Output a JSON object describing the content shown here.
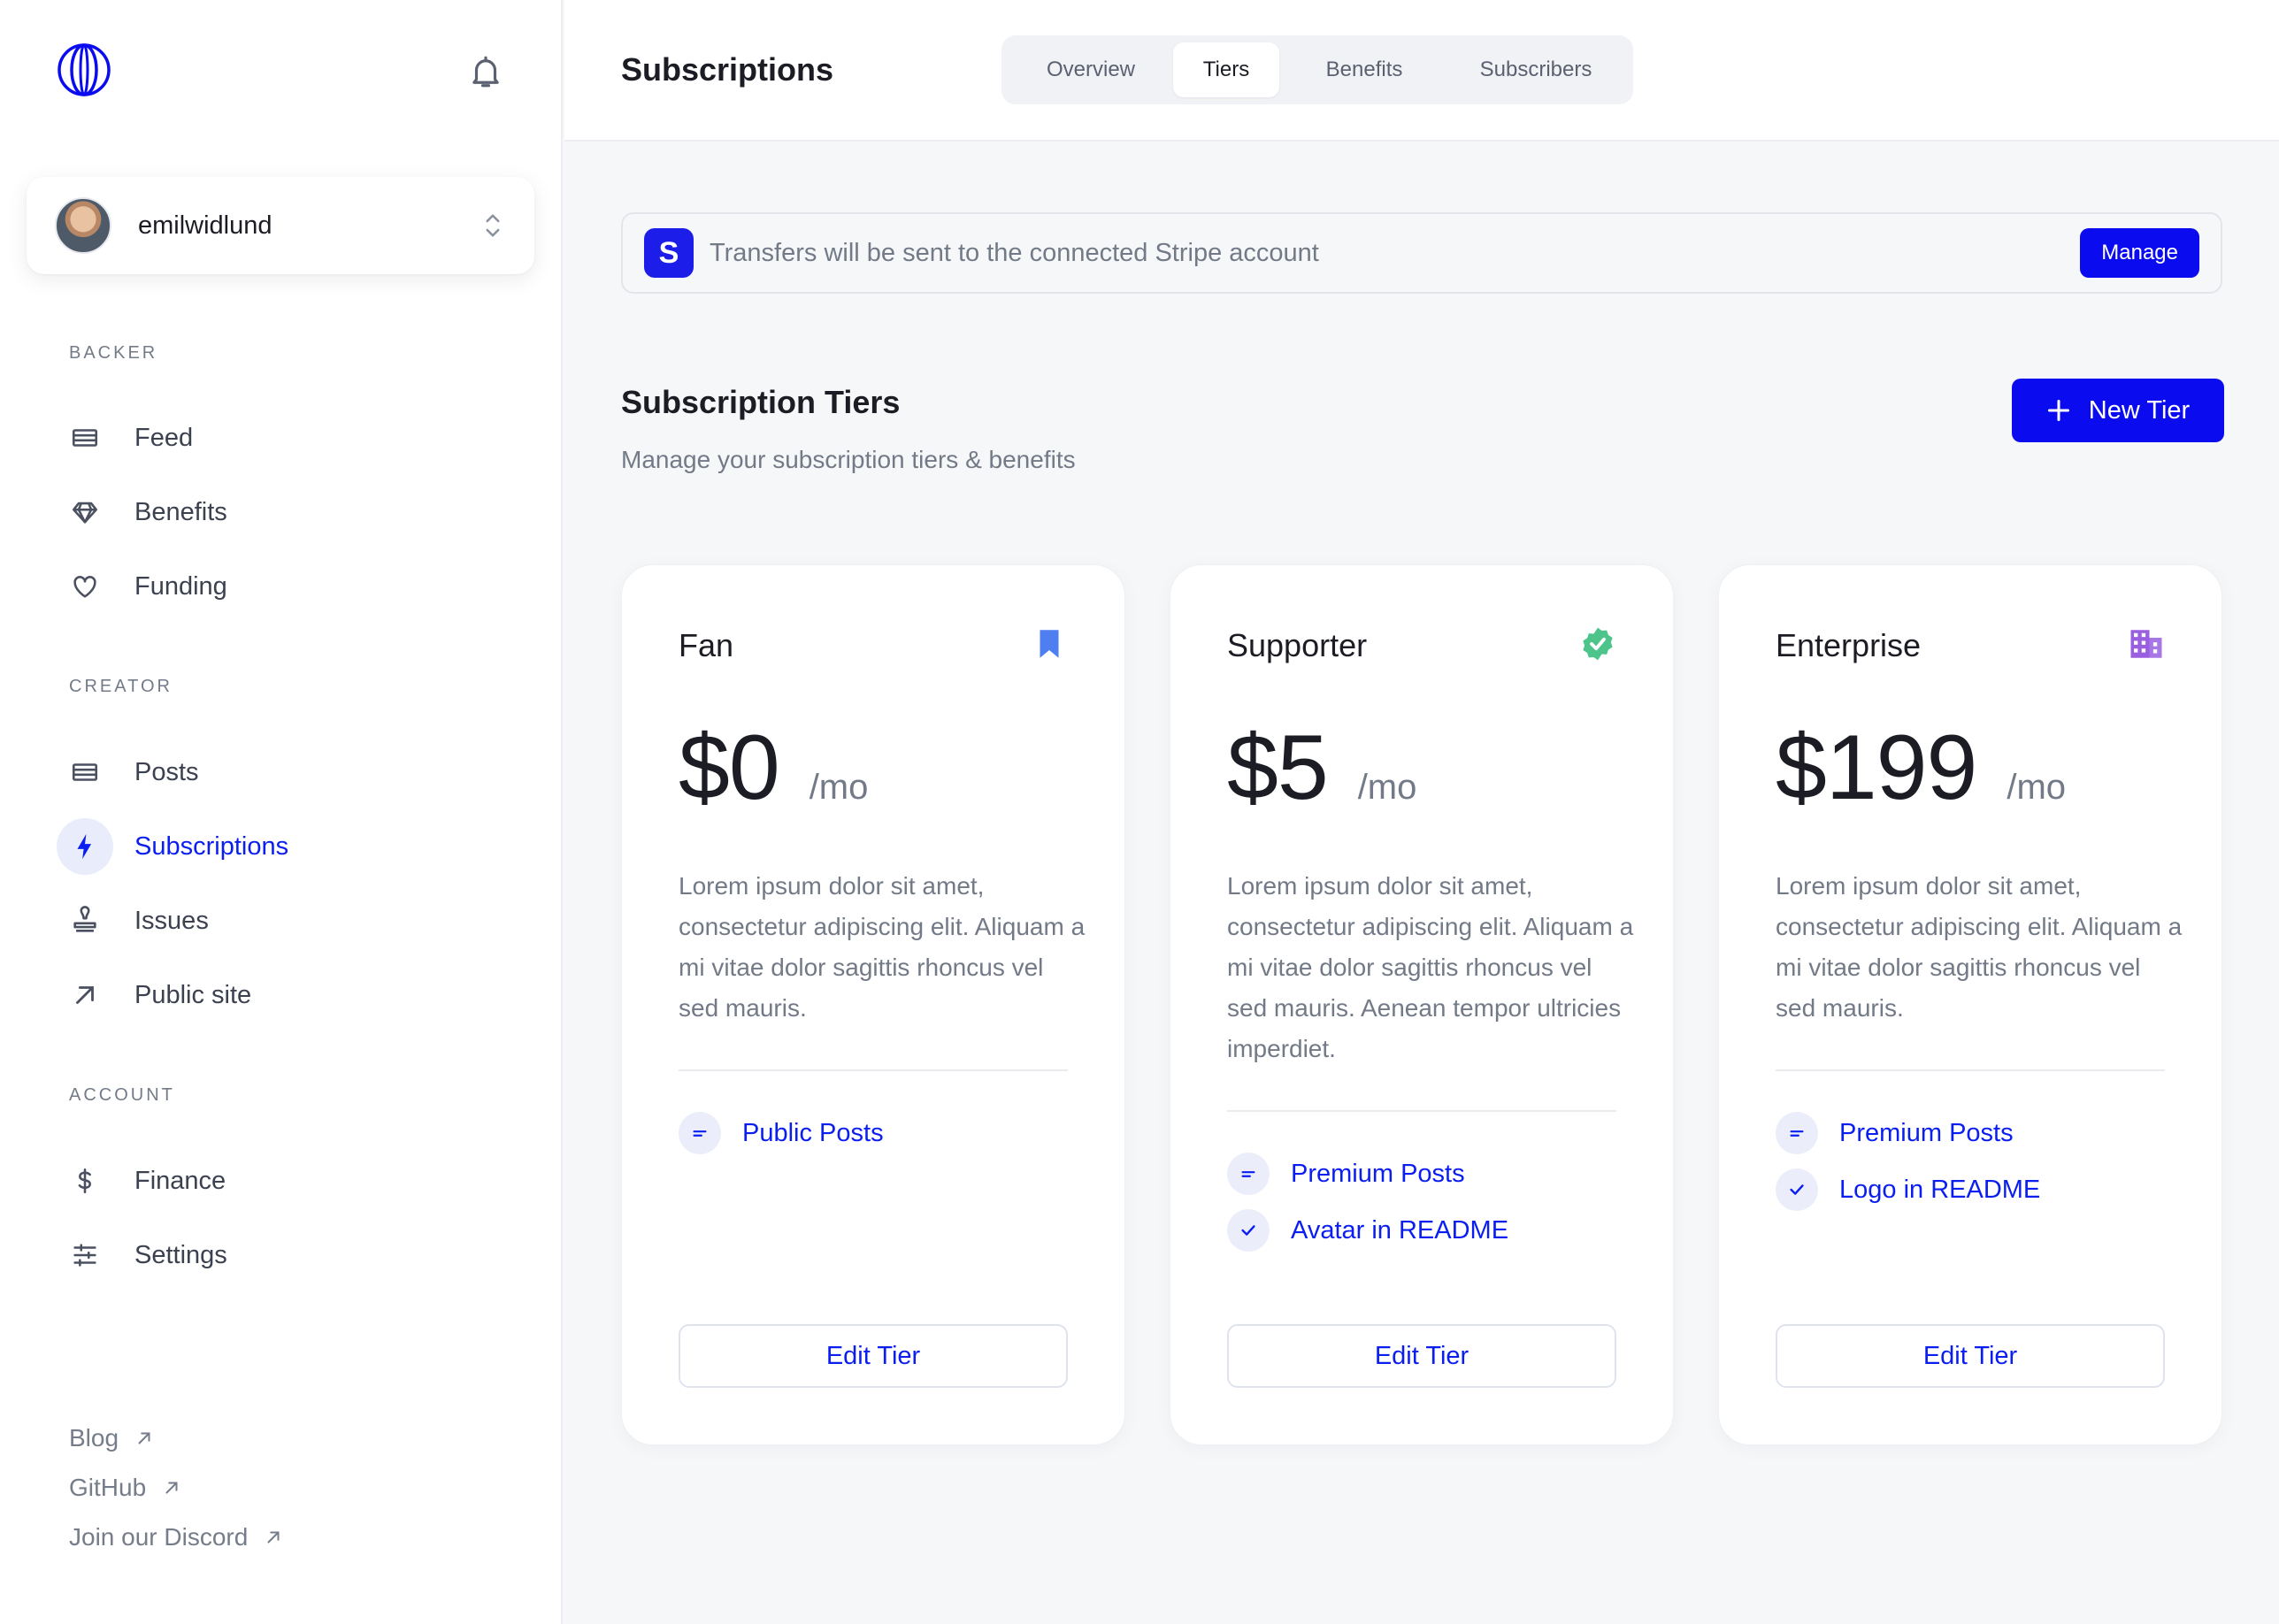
{
  "colors": {
    "accent": "#0b0bf0",
    "accent_text": "#0b1ef0",
    "fan_icon": "#4e7ef0",
    "supporter_icon": "#4cc48a",
    "enterprise_icon": "#9a5ee0"
  },
  "sidebar": {
    "account": {
      "username": "emilwidlund"
    },
    "sections": {
      "backer": "BACKER",
      "creator": "CREATOR",
      "account": "ACCOUNT"
    },
    "items": {
      "feed": "Feed",
      "benefits": "Benefits",
      "funding": "Funding",
      "posts": "Posts",
      "subscriptions": "Subscriptions",
      "issues": "Issues",
      "public_site": "Public site",
      "finance": "Finance",
      "settings": "Settings"
    },
    "footer": {
      "blog": "Blog",
      "github": "GitHub",
      "discord": "Join our Discord"
    }
  },
  "header": {
    "title": "Subscriptions",
    "tabs": [
      "Overview",
      "Tiers",
      "Benefits",
      "Subscribers"
    ],
    "active_tab": "Tiers"
  },
  "banner": {
    "logo_letter": "S",
    "text": "Transfers will be sent to the connected Stripe account",
    "button": "Manage"
  },
  "tiers_section": {
    "title": "Subscription Tiers",
    "subtitle": "Manage your subscription tiers & benefits",
    "new_button": "New Tier"
  },
  "tiers": [
    {
      "name": "Fan",
      "icon": "bookmark-icon",
      "price": "$0",
      "period": "/mo",
      "description": "Lorem ipsum dolor sit amet, consectetur adipiscing elit. Aliquam a mi vitae dolor sagittis rhoncus vel sed mauris.",
      "benefits": [
        {
          "label": "Public Posts",
          "icon": "lines-icon"
        }
      ],
      "button": "Edit Tier"
    },
    {
      "name": "Supporter",
      "icon": "verified-badge-icon",
      "price": "$5",
      "period": "/mo",
      "description": "Lorem ipsum dolor sit amet, consectetur adipiscing elit. Aliquam a mi vitae dolor sagittis rhoncus vel sed mauris. Aenean tempor ultricies imperdiet.",
      "benefits": [
        {
          "label": "Premium Posts",
          "icon": "lines-icon"
        },
        {
          "label": "Avatar in README",
          "icon": "check-icon"
        }
      ],
      "button": "Edit Tier"
    },
    {
      "name": "Enterprise",
      "icon": "building-icon",
      "price": "$199",
      "period": "/mo",
      "description": "Lorem ipsum dolor sit amet, consectetur adipiscing elit. Aliquam a mi vitae dolor sagittis rhoncus vel sed mauris.",
      "benefits": [
        {
          "label": "Premium Posts",
          "icon": "lines-icon"
        },
        {
          "label": "Logo in README",
          "icon": "check-icon"
        }
      ],
      "button": "Edit Tier"
    }
  ]
}
